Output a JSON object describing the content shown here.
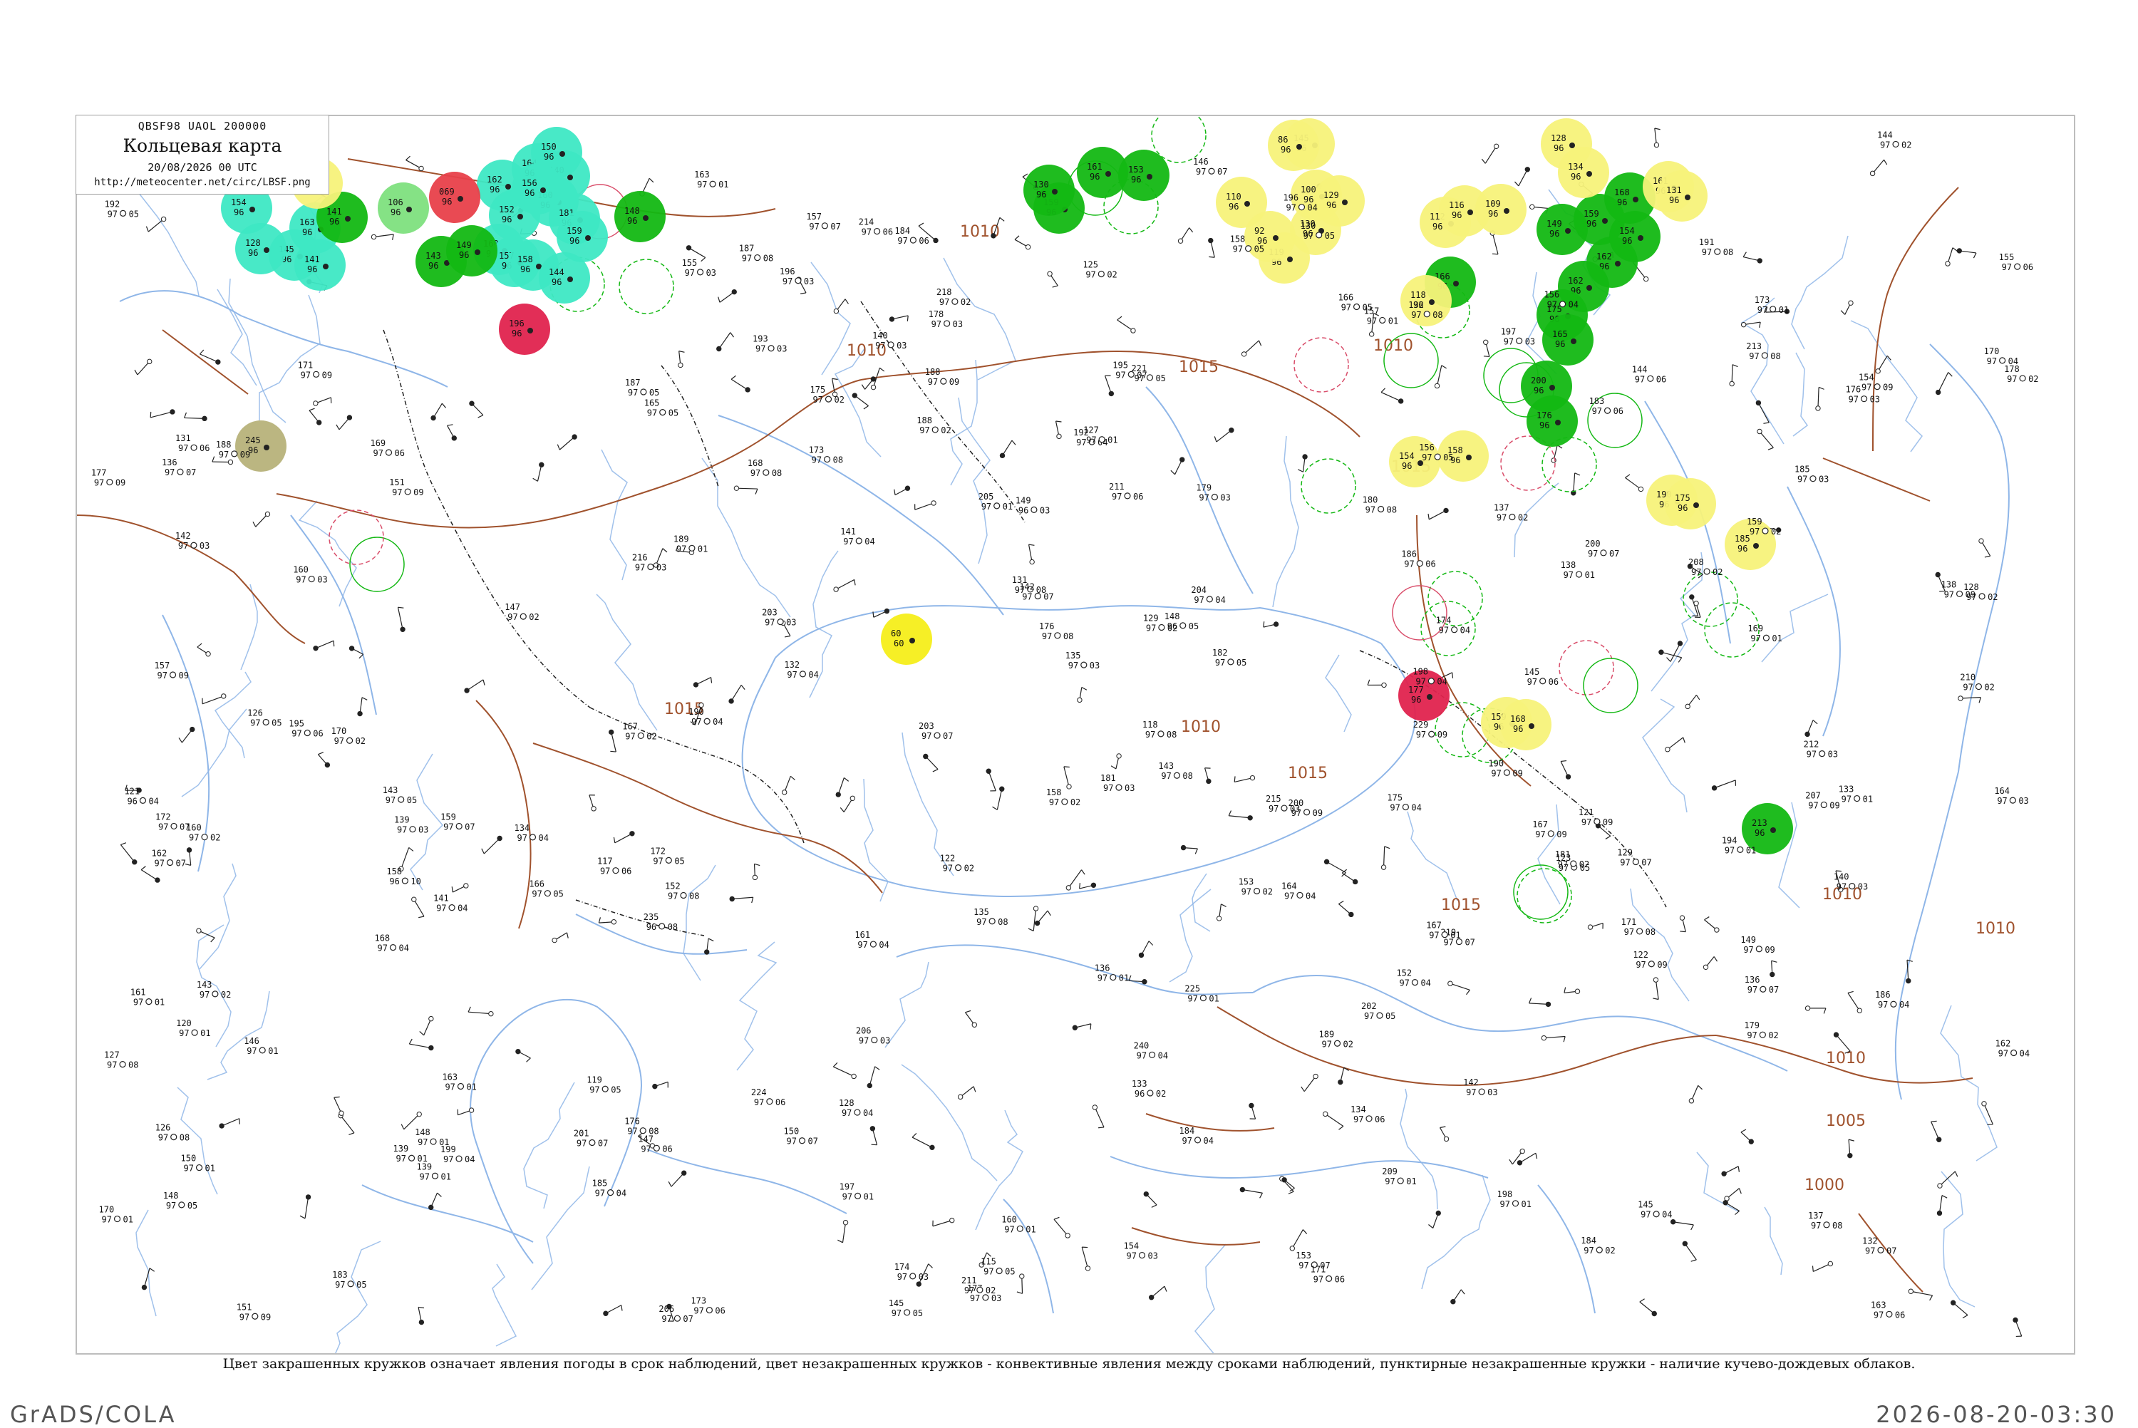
{
  "header": {
    "line1": "QBSF98  UAOL  200000",
    "title": "Кольцевая карта",
    "date": "20/08/2026 00 UTC",
    "url": "http://meteocenter.net/circ/LBSF.png"
  },
  "legend_text": "Цвет закрашенных кружков означает явления погоды в срок наблюдений, цвет незакрашенных кружков - конвективные явления между сроками наблюдений, пунктирные незакрашенные кружки - наличие кучево-дождевых облаков.",
  "footer": {
    "left": "GrADS/COLA",
    "right": "2026-08-20-03:30"
  },
  "colors": {
    "coast": "#8fb6e8",
    "isobar": "#a0522d",
    "border": "#222222",
    "teal": "#3ee8c4",
    "green": "#13b813",
    "light_green": "#7ee07e",
    "red": "#e8404a",
    "crimson": "#e0234e",
    "yellow": "#f7f27a",
    "bright_yellow": "#f5ee1a",
    "olive": "#b7b27a"
  },
  "isobar_labels": [
    {
      "text": "1005",
      "kind": "isobar"
    },
    {
      "text": "1010",
      "kind": "isobar"
    },
    {
      "text": "1010",
      "kind": "isobar"
    },
    {
      "text": "1010",
      "kind": "isobar"
    },
    {
      "text": "1010",
      "kind": "isobar"
    },
    {
      "text": "1015",
      "kind": "isobar"
    },
    {
      "text": "1015",
      "kind": "isobar"
    },
    {
      "text": "1015",
      "kind": "isobar"
    },
    {
      "text": "1015",
      "kind": "isobar"
    },
    {
      "text": "1010",
      "kind": "isobar"
    },
    {
      "text": "1010",
      "kind": "isobar"
    },
    {
      "text": "1005",
      "kind": "isobar"
    },
    {
      "text": "1000",
      "kind": "isobar"
    },
    {
      "text": "1015",
      "kind": "isobar"
    },
    {
      "text": "1010",
      "kind": "isobar"
    }
  ],
  "stations": [
    {
      "t": "145",
      "p": "97",
      "w": "04"
    },
    {
      "t": "187",
      "p": "97",
      "w": "05"
    },
    {
      "t": "161",
      "p": "97",
      "w": "01"
    },
    {
      "t": "170",
      "p": "97",
      "w": "04"
    },
    {
      "t": "149",
      "p": "96",
      "w": "03"
    },
    {
      "t": "132",
      "p": "97",
      "w": "08"
    },
    {
      "t": "164",
      "p": "97",
      "w": "04"
    },
    {
      "t": "158",
      "p": "96",
      "w": "10"
    },
    {
      "t": "190",
      "p": "97",
      "w": "09"
    },
    {
      "t": "182",
      "p": "97",
      "w": "05"
    },
    {
      "t": "173",
      "p": "97",
      "w": "01"
    },
    {
      "t": "137",
      "p": "97",
      "w": "02"
    },
    {
      "t": "120",
      "p": "97",
      "w": "01"
    },
    {
      "t": "155",
      "p": "97",
      "w": "03"
    },
    {
      "t": "204",
      "p": "97",
      "w": "09"
    },
    {
      "t": "167",
      "p": "97",
      "w": "02"
    },
    {
      "t": "211",
      "p": "97",
      "w": "06"
    },
    {
      "t": "235",
      "p": "96",
      "w": "08"
    },
    {
      "t": "200",
      "p": "97",
      "w": "07"
    },
    {
      "t": "148",
      "p": "96",
      "w": "05"
    },
    {
      "t": "176",
      "p": "97",
      "w": "03"
    },
    {
      "t": "139",
      "p": "97",
      "w": "01"
    },
    {
      "t": "153",
      "p": "97",
      "w": "02"
    },
    {
      "t": "118",
      "p": "97",
      "w": "08"
    },
    {
      "t": "203",
      "p": "97",
      "w": "07"
    },
    {
      "t": "121",
      "p": "96",
      "w": "04"
    },
    {
      "t": "156",
      "p": "97",
      "w": "05"
    },
    {
      "t": "163",
      "p": "97",
      "w": "01"
    },
    {
      "t": "197",
      "p": "97",
      "w": "03"
    },
    {
      "t": "128",
      "p": "97",
      "w": "02"
    },
    {
      "t": "240",
      "p": "97",
      "w": "04"
    },
    {
      "t": "171",
      "p": "97",
      "w": "09"
    },
    {
      "t": "184",
      "p": "97",
      "w": "06"
    },
    {
      "t": "142",
      "p": "97",
      "w": "03"
    },
    {
      "t": "159",
      "p": "97",
      "w": "07"
    },
    {
      "t": "225",
      "p": "97",
      "w": "01"
    },
    {
      "t": "133",
      "p": "96",
      "w": "02"
    },
    {
      "t": "168",
      "p": "97",
      "w": "08"
    },
    {
      "t": "192",
      "p": "97",
      "w": "04"
    },
    {
      "t": "115",
      "p": "97",
      "w": "05"
    },
    {
      "t": "210",
      "p": "97",
      "w": "02"
    },
    {
      "t": "147",
      "p": "97",
      "w": "06"
    },
    {
      "t": "179",
      "p": "97",
      "w": "03"
    },
    {
      "t": "136",
      "p": "97",
      "w": "01"
    },
    {
      "t": "151",
      "p": "97",
      "w": "09"
    },
    {
      "t": "198",
      "p": "97",
      "w": "04"
    },
    {
      "t": "124",
      "p": "97",
      "w": "07"
    },
    {
      "t": "188",
      "p": "97",
      "w": "02"
    },
    {
      "t": "166",
      "p": "97",
      "w": "05"
    },
    {
      "t": "143",
      "p": "97",
      "w": "08"
    },
    {
      "t": "215",
      "p": "97",
      "w": "03"
    },
    {
      "t": "157",
      "p": "97",
      "w": "01"
    },
    {
      "t": "131",
      "p": "97",
      "w": "06"
    },
    {
      "t": "174",
      "p": "97",
      "w": "04"
    },
    {
      "t": "208",
      "p": "97",
      "w": "02"
    },
    {
      "t": "162",
      "p": "97",
      "w": "07"
    },
    {
      "t": "119",
      "p": "97",
      "w": "05"
    },
    {
      "t": "185",
      "p": "97",
      "w": "03"
    },
    {
      "t": "150",
      "p": "97",
      "w": "01"
    },
    {
      "t": "229",
      "p": "97",
      "w": "09"
    },
    {
      "t": "141",
      "p": "97",
      "w": "04"
    },
    {
      "t": "178",
      "p": "97",
      "w": "02"
    },
    {
      "t": "195",
      "p": "97",
      "w": "06"
    },
    {
      "t": "127",
      "p": "97",
      "w": "08"
    },
    {
      "t": "160",
      "p": "97",
      "w": "03"
    },
    {
      "t": "172",
      "p": "97",
      "w": "05"
    },
    {
      "t": "146",
      "p": "97",
      "w": "01"
    },
    {
      "t": "206",
      "p": "97",
      "w": "07"
    },
    {
      "t": "134",
      "p": "97",
      "w": "04"
    },
    {
      "t": "189",
      "p": "97",
      "w": "02"
    },
    {
      "t": "154",
      "p": "97",
      "w": "09"
    },
    {
      "t": "117",
      "p": "97",
      "w": "06"
    },
    {
      "t": "181",
      "p": "97",
      "w": "03"
    },
    {
      "t": "165",
      "p": "97",
      "w": "05"
    },
    {
      "t": "139",
      "p": "97",
      "w": "01"
    },
    {
      "t": "213",
      "p": "97",
      "w": "08"
    },
    {
      "t": "152",
      "p": "97",
      "w": "04"
    },
    {
      "t": "175",
      "p": "97",
      "w": "02"
    },
    {
      "t": "129",
      "p": "97",
      "w": "07"
    },
    {
      "t": "193",
      "p": "97",
      "w": "03"
    },
    {
      "t": "144",
      "p": "97",
      "w": "06"
    },
    {
      "t": "169",
      "p": "97",
      "w": "01"
    },
    {
      "t": "202",
      "p": "97",
      "w": "05"
    },
    {
      "t": "122",
      "p": "97",
      "w": "09"
    },
    {
      "t": "186",
      "p": "97",
      "w": "04"
    },
    {
      "t": "158",
      "p": "97",
      "w": "02"
    },
    {
      "t": "135",
      "p": "97",
      "w": "08"
    },
    {
      "t": "177",
      "p": "97",
      "w": "03"
    },
    {
      "t": "219",
      "p": "97",
      "w": "07"
    },
    {
      "t": "148",
      "p": "97",
      "w": "01"
    },
    {
      "t": "163",
      "p": "97",
      "w": "06"
    },
    {
      "t": "196",
      "p": "97",
      "w": "04"
    },
    {
      "t": "125",
      "p": "97",
      "w": "02"
    },
    {
      "t": "183",
      "p": "97",
      "w": "05"
    },
    {
      "t": "157",
      "p": "97",
      "w": "09"
    },
    {
      "t": "140",
      "p": "97",
      "w": "03"
    },
    {
      "t": "171",
      "p": "97",
      "w": "08"
    },
    {
      "t": "209",
      "p": "97",
      "w": "01"
    },
    {
      "t": "132",
      "p": "97",
      "w": "07"
    },
    {
      "t": "190",
      "p": "97",
      "w": "04"
    },
    {
      "t": "160",
      "p": "97",
      "w": "02"
    },
    {
      "t": "145",
      "p": "97",
      "w": "06"
    },
    {
      "t": "178",
      "p": "97",
      "w": "03"
    },
    {
      "t": "221",
      "p": "97",
      "w": "05"
    },
    {
      "t": "138",
      "p": "97",
      "w": "09"
    },
    {
      "t": "167",
      "p": "97",
      "w": "01"
    },
    {
      "t": "199",
      "p": "97",
      "w": "04"
    },
    {
      "t": "126",
      "p": "97",
      "w": "08"
    },
    {
      "t": "184",
      "p": "97",
      "w": "02"
    },
    {
      "t": "153",
      "p": "97",
      "w": "07"
    },
    {
      "t": "142",
      "p": "97",
      "w": "03"
    },
    {
      "t": "173",
      "p": "97",
      "w": "06"
    },
    {
      "t": "205",
      "p": "97",
      "w": "01"
    },
    {
      "t": "130",
      "p": "97",
      "w": "05"
    },
    {
      "t": "188",
      "p": "97",
      "w": "09"
    },
    {
      "t": "161",
      "p": "97",
      "w": "04"
    },
    {
      "t": "147",
      "p": "97",
      "w": "02"
    },
    {
      "t": "176",
      "p": "97",
      "w": "08"
    },
    {
      "t": "212",
      "p": "97",
      "w": "03"
    },
    {
      "t": "136",
      "p": "97",
      "w": "07"
    },
    {
      "t": "194",
      "p": "97",
      "w": "01"
    },
    {
      "t": "155",
      "p": "97",
      "w": "06"
    },
    {
      "t": "168",
      "p": "97",
      "w": "04"
    },
    {
      "t": "123",
      "p": "97",
      "w": "05"
    },
    {
      "t": "181",
      "p": "97",
      "w": "02"
    },
    {
      "t": "149",
      "p": "97",
      "w": "09"
    },
    {
      "t": "216",
      "p": "97",
      "w": "03"
    },
    {
      "t": "137",
      "p": "97",
      "w": "08"
    },
    {
      "t": "170",
      "p": "97",
      "w": "01"
    },
    {
      "t": "201",
      "p": "97",
      "w": "07"
    },
    {
      "t": "128",
      "p": "97",
      "w": "04"
    },
    {
      "t": "186",
      "p": "97",
      "w": "06"
    },
    {
      "t": "159",
      "p": "97",
      "w": "02"
    },
    {
      "t": "143",
      "p": "97",
      "w": "05"
    },
    {
      "t": "174",
      "p": "97",
      "w": "03"
    },
    {
      "t": "207",
      "p": "97",
      "w": "09"
    },
    {
      "t": "133",
      "p": "97",
      "w": "01"
    },
    {
      "t": "191",
      "p": "97",
      "w": "08"
    },
    {
      "t": "162",
      "p": "97",
      "w": "04"
    },
    {
      "t": "146",
      "p": "97",
      "w": "07"
    },
    {
      "t": "179",
      "p": "97",
      "w": "02"
    },
    {
      "t": "224",
      "p": "97",
      "w": "06"
    },
    {
      "t": "139",
      "p": "97",
      "w": "03"
    },
    {
      "t": "166",
      "p": "97",
      "w": "05"
    },
    {
      "t": "197",
      "p": "97",
      "w": "01"
    },
    {
      "t": "121",
      "p": "97",
      "w": "09"
    },
    {
      "t": "185",
      "p": "97",
      "w": "04"
    },
    {
      "t": "152",
      "p": "97",
      "w": "08"
    },
    {
      "t": "144",
      "p": "97",
      "w": "02"
    },
    {
      "t": "172",
      "p": "97",
      "w": "07"
    },
    {
      "t": "203",
      "p": "97",
      "w": "03"
    },
    {
      "t": "134",
      "p": "97",
      "w": "06"
    },
    {
      "t": "189",
      "p": "97",
      "w": "01"
    },
    {
      "t": "158",
      "p": "97",
      "w": "05"
    },
    {
      "t": "141",
      "p": "97",
      "w": "04"
    },
    {
      "t": "177",
      "p": "97",
      "w": "09"
    },
    {
      "t": "218",
      "p": "97",
      "w": "02"
    },
    {
      "t": "131",
      "p": "97",
      "w": "08"
    },
    {
      "t": "164",
      "p": "97",
      "w": "03"
    },
    {
      "t": "195",
      "p": "97",
      "w": "07"
    },
    {
      "t": "127",
      "p": "97",
      "w": "01"
    },
    {
      "t": "183",
      "p": "97",
      "w": "06"
    },
    {
      "t": "156",
      "p": "97",
      "w": "04"
    },
    {
      "t": "148",
      "p": "97",
      "w": "05"
    },
    {
      "t": "170",
      "p": "97",
      "w": "02"
    },
    {
      "t": "200",
      "p": "97",
      "w": "09"
    },
    {
      "t": "135",
      "p": "97",
      "w": "03"
    },
    {
      "t": "187",
      "p": "97",
      "w": "08"
    },
    {
      "t": "160",
      "p": "97",
      "w": "01"
    },
    {
      "t": "142",
      "p": "97",
      "w": "07"
    },
    {
      "t": "175",
      "p": "97",
      "w": "04"
    },
    {
      "t": "214",
      "p": "97",
      "w": "06"
    },
    {
      "t": "129",
      "p": "97",
      "w": "02"
    },
    {
      "t": "192",
      "p": "97",
      "w": "05"
    },
    {
      "t": "154",
      "p": "97",
      "w": "03"
    },
    {
      "t": "167",
      "p": "97",
      "w": "09"
    },
    {
      "t": "138",
      "p": "97",
      "w": "01"
    },
    {
      "t": "180",
      "p": "97",
      "w": "08"
    },
    {
      "t": "204",
      "p": "97",
      "w": "04"
    },
    {
      "t": "150",
      "p": "97",
      "w": "07"
    },
    {
      "t": "122",
      "p": "97",
      "w": "02"
    },
    {
      "t": "171",
      "p": "97",
      "w": "06"
    },
    {
      "t": "196",
      "p": "97",
      "w": "03"
    },
    {
      "t": "145",
      "p": "97",
      "w": "05"
    },
    {
      "t": "163",
      "p": "97",
      "w": "01"
    },
    {
      "t": "188",
      "p": "97",
      "w": "09"
    },
    {
      "t": "132",
      "p": "97",
      "w": "04"
    },
    {
      "t": "176",
      "p": "97",
      "w": "08"
    },
    {
      "t": "211",
      "p": "97",
      "w": "02"
    },
    {
      "t": "157",
      "p": "97",
      "w": "07"
    },
    {
      "t": "140",
      "p": "97",
      "w": "03"
    },
    {
      "t": "169",
      "p": "97",
      "w": "06"
    },
    {
      "t": "198",
      "p": "97",
      "w": "01"
    },
    {
      "t": "126",
      "p": "97",
      "w": "05"
    },
    {
      "t": "184",
      "p": "97",
      "w": "04"
    },
    {
      "t": "151",
      "p": "97",
      "w": "09"
    },
    {
      "t": "143",
      "p": "97",
      "w": "02"
    },
    {
      "t": "173",
      "p": "97",
      "w": "08"
    },
    {
      "t": "206",
      "p": "97",
      "w": "03"
    },
    {
      "t": "136",
      "p": "97",
      "w": "07"
    }
  ],
  "weather_circles": [
    {
      "color": "teal",
      "t": "154",
      "p": "96"
    },
    {
      "color": "teal",
      "t": "145",
      "p": "96"
    },
    {
      "color": "teal",
      "t": "163",
      "p": "96"
    },
    {
      "color": "teal",
      "t": "141",
      "p": "96"
    },
    {
      "color": "teal",
      "t": "128",
      "p": "96"
    },
    {
      "color": "teal",
      "t": "162",
      "p": "96"
    },
    {
      "color": "teal",
      "t": "152",
      "p": "96"
    },
    {
      "color": "teal",
      "t": "160",
      "p": "96"
    },
    {
      "color": "teal",
      "t": "157",
      "p": "96"
    },
    {
      "color": "teal",
      "t": "158",
      "p": "96"
    },
    {
      "color": "teal",
      "t": "164",
      "p": "96"
    },
    {
      "color": "teal",
      "t": "140",
      "p": "96"
    },
    {
      "color": "teal",
      "t": "160",
      "p": "96"
    },
    {
      "color": "teal",
      "t": "181",
      "p": "96"
    },
    {
      "color": "teal",
      "t": "159",
      "p": "96"
    },
    {
      "color": "teal",
      "t": "144",
      "p": "96"
    },
    {
      "color": "teal",
      "t": "156",
      "p": "96"
    },
    {
      "color": "teal",
      "t": "150",
      "p": "96"
    },
    {
      "color": "green",
      "t": "141",
      "p": "96"
    },
    {
      "color": "green",
      "t": "143",
      "p": "96"
    },
    {
      "color": "green",
      "t": "149",
      "p": "96"
    },
    {
      "color": "green",
      "t": "148",
      "p": "96"
    },
    {
      "color": "green",
      "t": "159",
      "p": "96"
    },
    {
      "color": "green",
      "t": "161",
      "p": "96"
    },
    {
      "color": "green",
      "t": "153",
      "p": "96"
    },
    {
      "color": "green",
      "t": "166",
      "p": "96"
    },
    {
      "color": "green",
      "t": "149",
      "p": "96"
    },
    {
      "color": "green",
      "t": "159",
      "p": "96"
    },
    {
      "color": "green",
      "t": "162",
      "p": "96"
    },
    {
      "color": "green",
      "t": "154",
      "p": "96"
    },
    {
      "color": "green",
      "t": "168",
      "p": "96"
    },
    {
      "color": "green",
      "t": "162",
      "p": "96"
    },
    {
      "color": "green",
      "t": "175",
      "p": "96"
    },
    {
      "color": "green",
      "t": "165",
      "p": "96"
    },
    {
      "color": "green",
      "t": "200",
      "p": "96"
    },
    {
      "color": "green",
      "t": "176",
      "p": "96"
    },
    {
      "color": "green",
      "t": "213",
      "p": "96"
    },
    {
      "color": "green",
      "t": "130",
      "p": "96"
    },
    {
      "color": "light_green",
      "t": "106",
      "p": "96"
    },
    {
      "color": "red",
      "t": "069",
      "p": "96"
    },
    {
      "color": "crimson",
      "t": "196",
      "p": "96"
    },
    {
      "color": "crimson",
      "t": "177",
      "p": "96"
    },
    {
      "color": "yellow",
      "t": "120",
      "p": "96"
    },
    {
      "color": "yellow",
      "t": "145",
      "p": "96"
    },
    {
      "color": "yellow",
      "t": "100",
      "p": "96"
    },
    {
      "color": "yellow",
      "t": "129",
      "p": "96"
    },
    {
      "color": "yellow",
      "t": "130",
      "p": "96"
    },
    {
      "color": "yellow",
      "t": "119",
      "p": "96"
    },
    {
      "color": "yellow",
      "t": "128",
      "p": "96"
    },
    {
      "color": "yellow",
      "t": "134",
      "p": "96"
    },
    {
      "color": "yellow",
      "t": "161",
      "p": "96"
    },
    {
      "color": "yellow",
      "t": "131",
      "p": "96"
    },
    {
      "color": "yellow",
      "t": "112",
      "p": "96"
    },
    {
      "color": "yellow",
      "t": "116",
      "p": "96"
    },
    {
      "color": "yellow",
      "t": "109",
      "p": "96"
    },
    {
      "color": "yellow",
      "t": "118",
      "p": "96"
    },
    {
      "color": "yellow",
      "t": "154",
      "p": "96"
    },
    {
      "color": "yellow",
      "t": "158",
      "p": "96"
    },
    {
      "color": "yellow",
      "t": "190",
      "p": "96"
    },
    {
      "color": "yellow",
      "t": "175",
      "p": "96"
    },
    {
      "color": "yellow",
      "t": "185",
      "p": "96"
    },
    {
      "color": "yellow",
      "t": "159",
      "p": "96"
    },
    {
      "color": "yellow",
      "t": "168",
      "p": "96"
    },
    {
      "color": "yellow",
      "t": "110",
      "p": "96"
    },
    {
      "color": "yellow",
      "t": "86",
      "p": "96"
    },
    {
      "color": "yellow",
      "t": "92",
      "p": "96"
    },
    {
      "color": "bright_yellow",
      "t": "60",
      "p": "60"
    },
    {
      "color": "olive",
      "t": "245",
      "p": "96"
    }
  ],
  "outline_circles": 28,
  "wind_symbols": 240
}
